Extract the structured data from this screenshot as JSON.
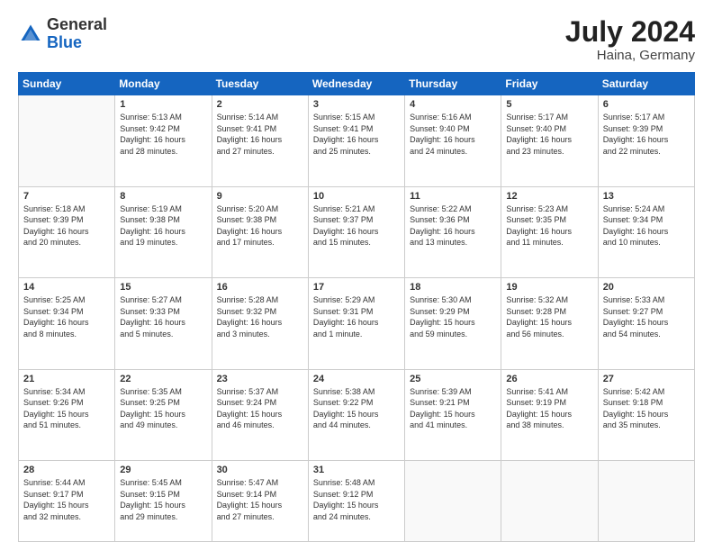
{
  "header": {
    "logo_general": "General",
    "logo_blue": "Blue",
    "month_year": "July 2024",
    "location": "Haina, Germany"
  },
  "weekdays": [
    "Sunday",
    "Monday",
    "Tuesday",
    "Wednesday",
    "Thursday",
    "Friday",
    "Saturday"
  ],
  "weeks": [
    [
      {
        "day": "",
        "info": ""
      },
      {
        "day": "1",
        "info": "Sunrise: 5:13 AM\nSunset: 9:42 PM\nDaylight: 16 hours\nand 28 minutes."
      },
      {
        "day": "2",
        "info": "Sunrise: 5:14 AM\nSunset: 9:41 PM\nDaylight: 16 hours\nand 27 minutes."
      },
      {
        "day": "3",
        "info": "Sunrise: 5:15 AM\nSunset: 9:41 PM\nDaylight: 16 hours\nand 25 minutes."
      },
      {
        "day": "4",
        "info": "Sunrise: 5:16 AM\nSunset: 9:40 PM\nDaylight: 16 hours\nand 24 minutes."
      },
      {
        "day": "5",
        "info": "Sunrise: 5:17 AM\nSunset: 9:40 PM\nDaylight: 16 hours\nand 23 minutes."
      },
      {
        "day": "6",
        "info": "Sunrise: 5:17 AM\nSunset: 9:39 PM\nDaylight: 16 hours\nand 22 minutes."
      }
    ],
    [
      {
        "day": "7",
        "info": "Sunrise: 5:18 AM\nSunset: 9:39 PM\nDaylight: 16 hours\nand 20 minutes."
      },
      {
        "day": "8",
        "info": "Sunrise: 5:19 AM\nSunset: 9:38 PM\nDaylight: 16 hours\nand 19 minutes."
      },
      {
        "day": "9",
        "info": "Sunrise: 5:20 AM\nSunset: 9:38 PM\nDaylight: 16 hours\nand 17 minutes."
      },
      {
        "day": "10",
        "info": "Sunrise: 5:21 AM\nSunset: 9:37 PM\nDaylight: 16 hours\nand 15 minutes."
      },
      {
        "day": "11",
        "info": "Sunrise: 5:22 AM\nSunset: 9:36 PM\nDaylight: 16 hours\nand 13 minutes."
      },
      {
        "day": "12",
        "info": "Sunrise: 5:23 AM\nSunset: 9:35 PM\nDaylight: 16 hours\nand 11 minutes."
      },
      {
        "day": "13",
        "info": "Sunrise: 5:24 AM\nSunset: 9:34 PM\nDaylight: 16 hours\nand 10 minutes."
      }
    ],
    [
      {
        "day": "14",
        "info": "Sunrise: 5:25 AM\nSunset: 9:34 PM\nDaylight: 16 hours\nand 8 minutes."
      },
      {
        "day": "15",
        "info": "Sunrise: 5:27 AM\nSunset: 9:33 PM\nDaylight: 16 hours\nand 5 minutes."
      },
      {
        "day": "16",
        "info": "Sunrise: 5:28 AM\nSunset: 9:32 PM\nDaylight: 16 hours\nand 3 minutes."
      },
      {
        "day": "17",
        "info": "Sunrise: 5:29 AM\nSunset: 9:31 PM\nDaylight: 16 hours\nand 1 minute."
      },
      {
        "day": "18",
        "info": "Sunrise: 5:30 AM\nSunset: 9:29 PM\nDaylight: 15 hours\nand 59 minutes."
      },
      {
        "day": "19",
        "info": "Sunrise: 5:32 AM\nSunset: 9:28 PM\nDaylight: 15 hours\nand 56 minutes."
      },
      {
        "day": "20",
        "info": "Sunrise: 5:33 AM\nSunset: 9:27 PM\nDaylight: 15 hours\nand 54 minutes."
      }
    ],
    [
      {
        "day": "21",
        "info": "Sunrise: 5:34 AM\nSunset: 9:26 PM\nDaylight: 15 hours\nand 51 minutes."
      },
      {
        "day": "22",
        "info": "Sunrise: 5:35 AM\nSunset: 9:25 PM\nDaylight: 15 hours\nand 49 minutes."
      },
      {
        "day": "23",
        "info": "Sunrise: 5:37 AM\nSunset: 9:24 PM\nDaylight: 15 hours\nand 46 minutes."
      },
      {
        "day": "24",
        "info": "Sunrise: 5:38 AM\nSunset: 9:22 PM\nDaylight: 15 hours\nand 44 minutes."
      },
      {
        "day": "25",
        "info": "Sunrise: 5:39 AM\nSunset: 9:21 PM\nDaylight: 15 hours\nand 41 minutes."
      },
      {
        "day": "26",
        "info": "Sunrise: 5:41 AM\nSunset: 9:19 PM\nDaylight: 15 hours\nand 38 minutes."
      },
      {
        "day": "27",
        "info": "Sunrise: 5:42 AM\nSunset: 9:18 PM\nDaylight: 15 hours\nand 35 minutes."
      }
    ],
    [
      {
        "day": "28",
        "info": "Sunrise: 5:44 AM\nSunset: 9:17 PM\nDaylight: 15 hours\nand 32 minutes."
      },
      {
        "day": "29",
        "info": "Sunrise: 5:45 AM\nSunset: 9:15 PM\nDaylight: 15 hours\nand 29 minutes."
      },
      {
        "day": "30",
        "info": "Sunrise: 5:47 AM\nSunset: 9:14 PM\nDaylight: 15 hours\nand 27 minutes."
      },
      {
        "day": "31",
        "info": "Sunrise: 5:48 AM\nSunset: 9:12 PM\nDaylight: 15 hours\nand 24 minutes."
      },
      {
        "day": "",
        "info": ""
      },
      {
        "day": "",
        "info": ""
      },
      {
        "day": "",
        "info": ""
      }
    ]
  ]
}
